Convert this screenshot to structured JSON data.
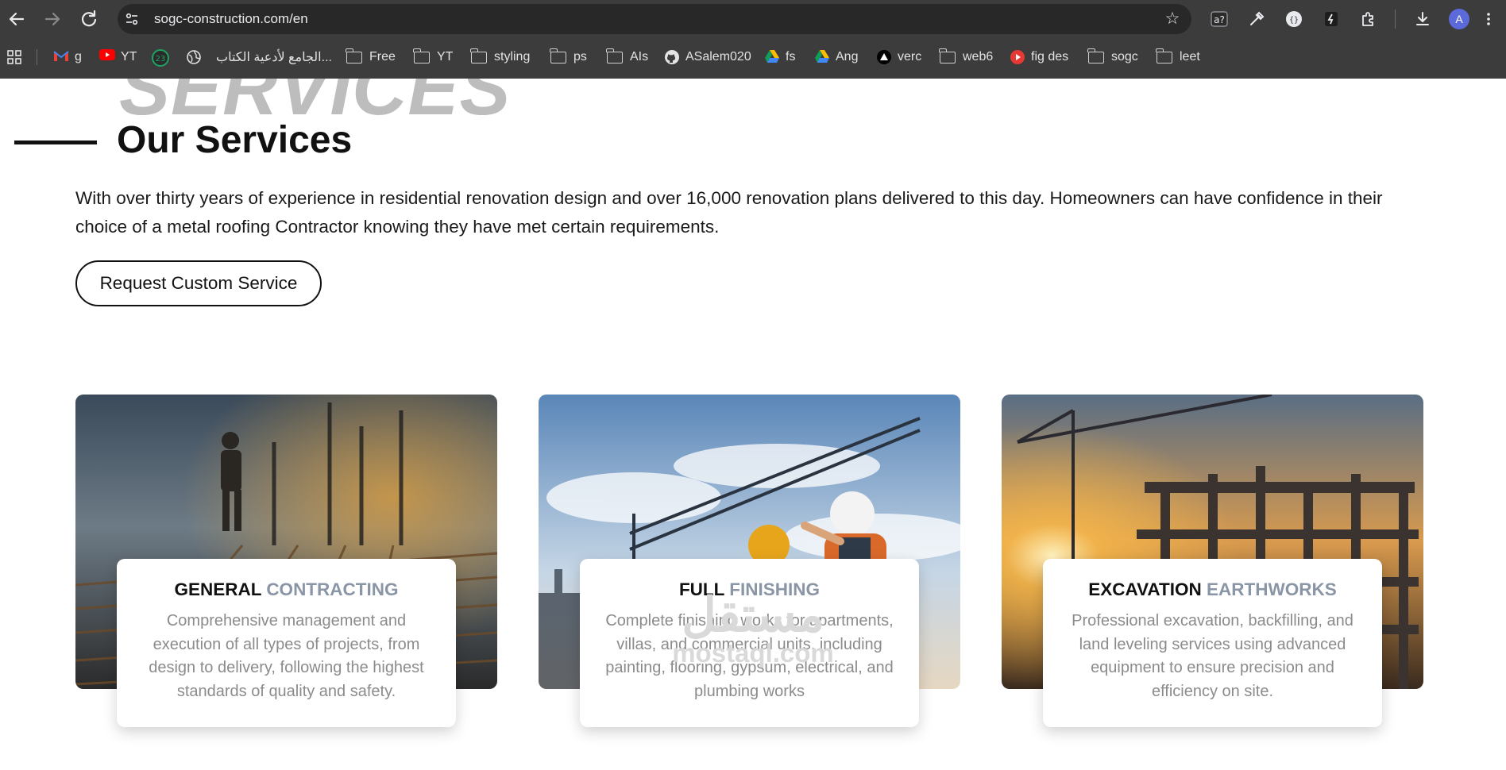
{
  "browser": {
    "url": "sogc-construction.com/en",
    "avatar_initial": "A",
    "extensions": [
      "translate-icon",
      "eyedropper-icon",
      "dev-icon",
      "ink-icon",
      "puzzle-icon"
    ],
    "bookmarks": [
      {
        "label": "g",
        "icon": "gmail-icon"
      },
      {
        "label": "YT",
        "icon": "youtube-icon"
      },
      {
        "label": "",
        "icon": "badge-23-icon",
        "badge": "23"
      },
      {
        "label": "",
        "icon": "globe-icon"
      },
      {
        "label": "الجامع لأدعية الكتاب...",
        "icon": "none"
      },
      {
        "label": "Free",
        "icon": "folder-icon"
      },
      {
        "label": "YT",
        "icon": "folder-icon"
      },
      {
        "label": "styling",
        "icon": "folder-icon"
      },
      {
        "label": "ps",
        "icon": "folder-icon"
      },
      {
        "label": "AIs",
        "icon": "folder-icon"
      },
      {
        "label": "ASalem020",
        "icon": "github-icon"
      },
      {
        "label": "fs",
        "icon": "drive-icon"
      },
      {
        "label": "Ang",
        "icon": "drive-icon"
      },
      {
        "label": "verc",
        "icon": "vercel-icon"
      },
      {
        "label": "web6",
        "icon": "folder-icon"
      },
      {
        "label": "fig des",
        "icon": "youtube-icon"
      },
      {
        "label": "sogc",
        "icon": "folder-icon"
      },
      {
        "label": "leet",
        "icon": "folder-icon"
      }
    ]
  },
  "hero": {
    "background_word": "SERVICES",
    "title": "Our Services",
    "intro": "With over thirty years of experience in residential renovation design and over 16,000 renovation plans delivered to this day. Homeowners can have confidence in their choice of a metal roofing Contractor knowing they have met certain requirements.",
    "cta_label": "Request Custom Service"
  },
  "services": [
    {
      "title_main": "GENERAL",
      "title_accent": "CONTRACTING",
      "description": "Comprehensive management and execution of all types of projects, from design to delivery, following the highest standards of quality and safety."
    },
    {
      "title_main": "FULL",
      "title_accent": "FINISHING",
      "description": "Complete finishing works for apartments, villas, and commercial units, including painting, flooring, gypsum, electrical, and plumbing works"
    },
    {
      "title_main": "EXCAVATION",
      "title_accent": "EARTHWORKS",
      "description": "Professional excavation, backfilling, and land leveling services using advanced equipment to ensure precision and efficiency on site."
    }
  ],
  "watermark": {
    "arabic": "مستقل",
    "latin": "mostaql.com"
  },
  "colors": {
    "browser_frame": "#3c3c3c",
    "omnibox": "#282828",
    "accent_text": "#8a95a6",
    "description_text": "#8b8b8b",
    "background_word": "#bdbdbd"
  }
}
